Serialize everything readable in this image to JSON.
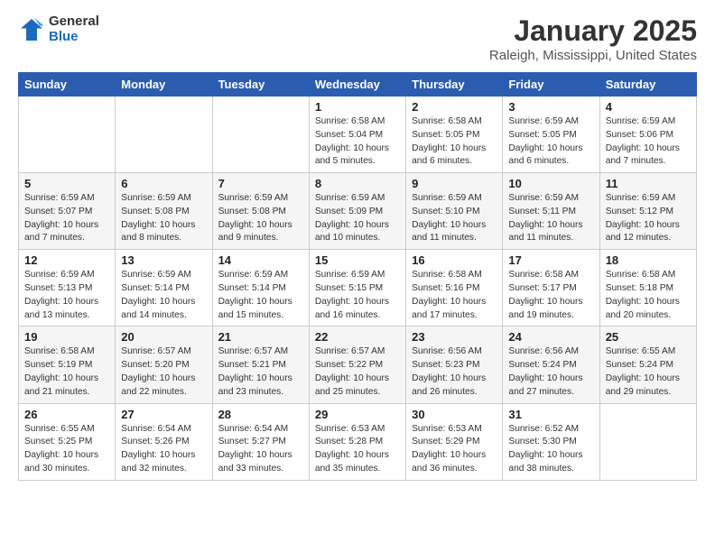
{
  "header": {
    "logo_general": "General",
    "logo_blue": "Blue",
    "month_title": "January 2025",
    "location": "Raleigh, Mississippi, United States"
  },
  "days_of_week": [
    "Sunday",
    "Monday",
    "Tuesday",
    "Wednesday",
    "Thursday",
    "Friday",
    "Saturday"
  ],
  "weeks": [
    [
      {
        "day": "",
        "info": ""
      },
      {
        "day": "",
        "info": ""
      },
      {
        "day": "",
        "info": ""
      },
      {
        "day": "1",
        "info": "Sunrise: 6:58 AM\nSunset: 5:04 PM\nDaylight: 10 hours\nand 5 minutes."
      },
      {
        "day": "2",
        "info": "Sunrise: 6:58 AM\nSunset: 5:05 PM\nDaylight: 10 hours\nand 6 minutes."
      },
      {
        "day": "3",
        "info": "Sunrise: 6:59 AM\nSunset: 5:05 PM\nDaylight: 10 hours\nand 6 minutes."
      },
      {
        "day": "4",
        "info": "Sunrise: 6:59 AM\nSunset: 5:06 PM\nDaylight: 10 hours\nand 7 minutes."
      }
    ],
    [
      {
        "day": "5",
        "info": "Sunrise: 6:59 AM\nSunset: 5:07 PM\nDaylight: 10 hours\nand 7 minutes."
      },
      {
        "day": "6",
        "info": "Sunrise: 6:59 AM\nSunset: 5:08 PM\nDaylight: 10 hours\nand 8 minutes."
      },
      {
        "day": "7",
        "info": "Sunrise: 6:59 AM\nSunset: 5:08 PM\nDaylight: 10 hours\nand 9 minutes."
      },
      {
        "day": "8",
        "info": "Sunrise: 6:59 AM\nSunset: 5:09 PM\nDaylight: 10 hours\nand 10 minutes."
      },
      {
        "day": "9",
        "info": "Sunrise: 6:59 AM\nSunset: 5:10 PM\nDaylight: 10 hours\nand 11 minutes."
      },
      {
        "day": "10",
        "info": "Sunrise: 6:59 AM\nSunset: 5:11 PM\nDaylight: 10 hours\nand 11 minutes."
      },
      {
        "day": "11",
        "info": "Sunrise: 6:59 AM\nSunset: 5:12 PM\nDaylight: 10 hours\nand 12 minutes."
      }
    ],
    [
      {
        "day": "12",
        "info": "Sunrise: 6:59 AM\nSunset: 5:13 PM\nDaylight: 10 hours\nand 13 minutes."
      },
      {
        "day": "13",
        "info": "Sunrise: 6:59 AM\nSunset: 5:14 PM\nDaylight: 10 hours\nand 14 minutes."
      },
      {
        "day": "14",
        "info": "Sunrise: 6:59 AM\nSunset: 5:14 PM\nDaylight: 10 hours\nand 15 minutes."
      },
      {
        "day": "15",
        "info": "Sunrise: 6:59 AM\nSunset: 5:15 PM\nDaylight: 10 hours\nand 16 minutes."
      },
      {
        "day": "16",
        "info": "Sunrise: 6:58 AM\nSunset: 5:16 PM\nDaylight: 10 hours\nand 17 minutes."
      },
      {
        "day": "17",
        "info": "Sunrise: 6:58 AM\nSunset: 5:17 PM\nDaylight: 10 hours\nand 19 minutes."
      },
      {
        "day": "18",
        "info": "Sunrise: 6:58 AM\nSunset: 5:18 PM\nDaylight: 10 hours\nand 20 minutes."
      }
    ],
    [
      {
        "day": "19",
        "info": "Sunrise: 6:58 AM\nSunset: 5:19 PM\nDaylight: 10 hours\nand 21 minutes."
      },
      {
        "day": "20",
        "info": "Sunrise: 6:57 AM\nSunset: 5:20 PM\nDaylight: 10 hours\nand 22 minutes."
      },
      {
        "day": "21",
        "info": "Sunrise: 6:57 AM\nSunset: 5:21 PM\nDaylight: 10 hours\nand 23 minutes."
      },
      {
        "day": "22",
        "info": "Sunrise: 6:57 AM\nSunset: 5:22 PM\nDaylight: 10 hours\nand 25 minutes."
      },
      {
        "day": "23",
        "info": "Sunrise: 6:56 AM\nSunset: 5:23 PM\nDaylight: 10 hours\nand 26 minutes."
      },
      {
        "day": "24",
        "info": "Sunrise: 6:56 AM\nSunset: 5:24 PM\nDaylight: 10 hours\nand 27 minutes."
      },
      {
        "day": "25",
        "info": "Sunrise: 6:55 AM\nSunset: 5:24 PM\nDaylight: 10 hours\nand 29 minutes."
      }
    ],
    [
      {
        "day": "26",
        "info": "Sunrise: 6:55 AM\nSunset: 5:25 PM\nDaylight: 10 hours\nand 30 minutes."
      },
      {
        "day": "27",
        "info": "Sunrise: 6:54 AM\nSunset: 5:26 PM\nDaylight: 10 hours\nand 32 minutes."
      },
      {
        "day": "28",
        "info": "Sunrise: 6:54 AM\nSunset: 5:27 PM\nDaylight: 10 hours\nand 33 minutes."
      },
      {
        "day": "29",
        "info": "Sunrise: 6:53 AM\nSunset: 5:28 PM\nDaylight: 10 hours\nand 35 minutes."
      },
      {
        "day": "30",
        "info": "Sunrise: 6:53 AM\nSunset: 5:29 PM\nDaylight: 10 hours\nand 36 minutes."
      },
      {
        "day": "31",
        "info": "Sunrise: 6:52 AM\nSunset: 5:30 PM\nDaylight: 10 hours\nand 38 minutes."
      },
      {
        "day": "",
        "info": ""
      }
    ]
  ]
}
